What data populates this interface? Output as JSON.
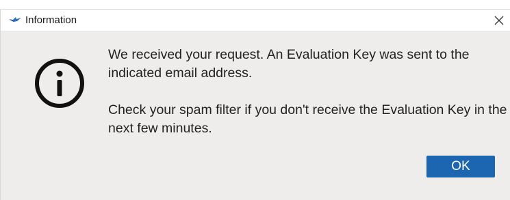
{
  "window": {
    "title": "Information",
    "app_icon": "bird-logo-icon",
    "close_icon": "close-icon"
  },
  "dialog": {
    "icon": "info-icon",
    "message_line1": "We received your request. An Evaluation Key was sent to the indicated email address.",
    "message_line2": "Check your spam filter if you don't receive the Evaluation Key in the next few minutes.",
    "ok_label": "OK"
  },
  "colors": {
    "accent": "#1c65b0",
    "dialog_background": "#eeedec",
    "titlebar_background": "#ffffff",
    "logo_color": "#2f6fb5"
  }
}
